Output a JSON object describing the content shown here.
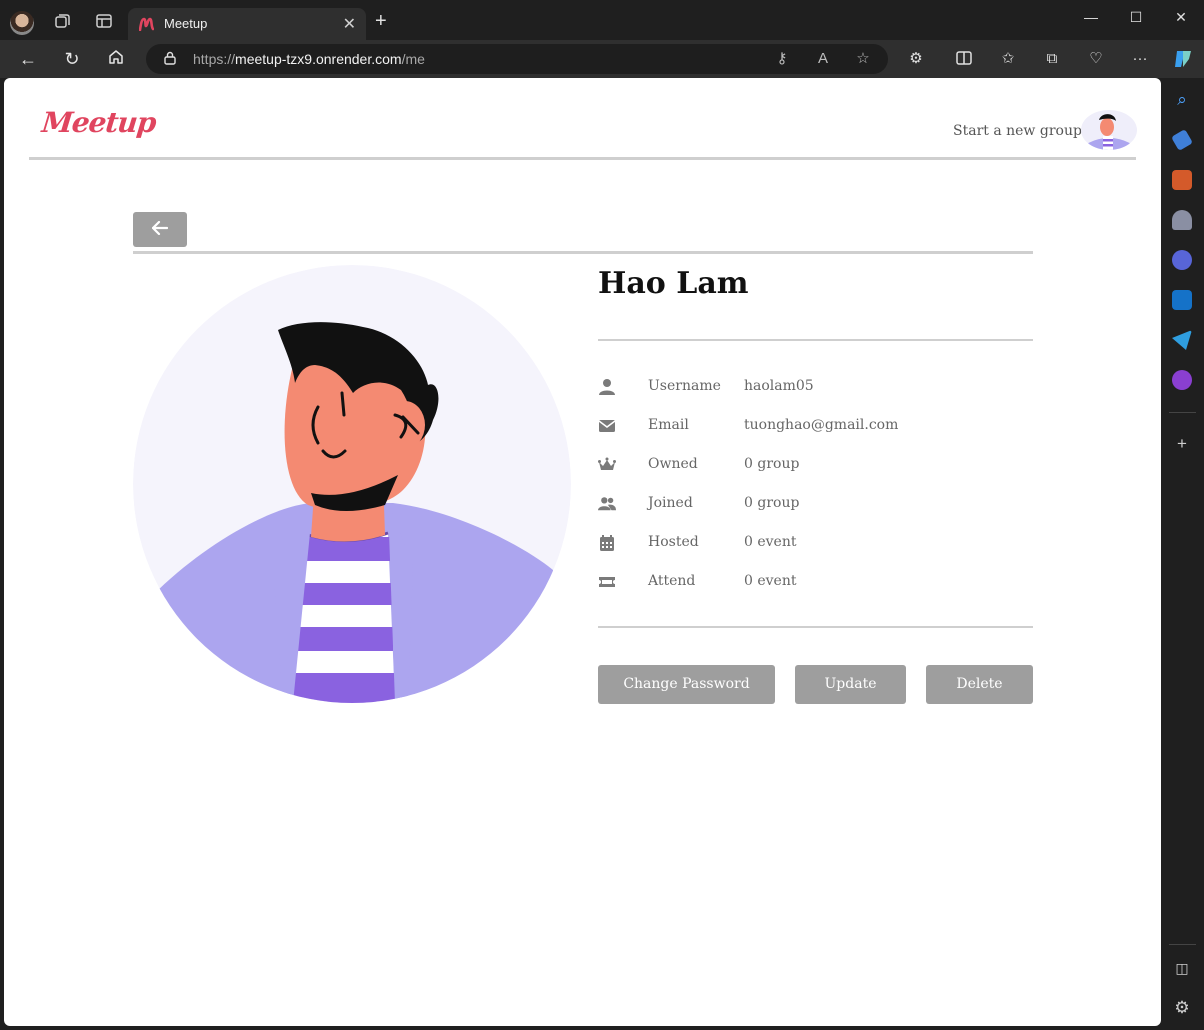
{
  "browser": {
    "tab_title": "Meetup",
    "url_host": "meetup-tzx9.onrender.com",
    "url_path": "/me",
    "url_scheme": "https://"
  },
  "header": {
    "logo": "Meetup",
    "start_group": "Start a new group"
  },
  "profile": {
    "name": "Hao Lam",
    "rows": [
      {
        "icon": "user-icon",
        "label": "Username",
        "value": "haolam05"
      },
      {
        "icon": "envelope-icon",
        "label": "Email",
        "value": "tuonghao@gmail.com"
      },
      {
        "icon": "crown-icon",
        "label": "Owned",
        "value": "0 group"
      },
      {
        "icon": "users-icon",
        "label": "Joined",
        "value": "0 group"
      },
      {
        "icon": "calendar-icon",
        "label": "Hosted",
        "value": "0 event"
      },
      {
        "icon": "ticket-icon",
        "label": "Attend",
        "value": "0 event"
      }
    ]
  },
  "actions": {
    "change_password": "Change Password",
    "update": "Update",
    "delete": "Delete"
  },
  "colors": {
    "brand": "#e0455f",
    "button": "#9e9e9e",
    "avatar_bg": "#f5f4fc",
    "shirt": "#aca5ef",
    "stripe": "#8a62e0"
  }
}
